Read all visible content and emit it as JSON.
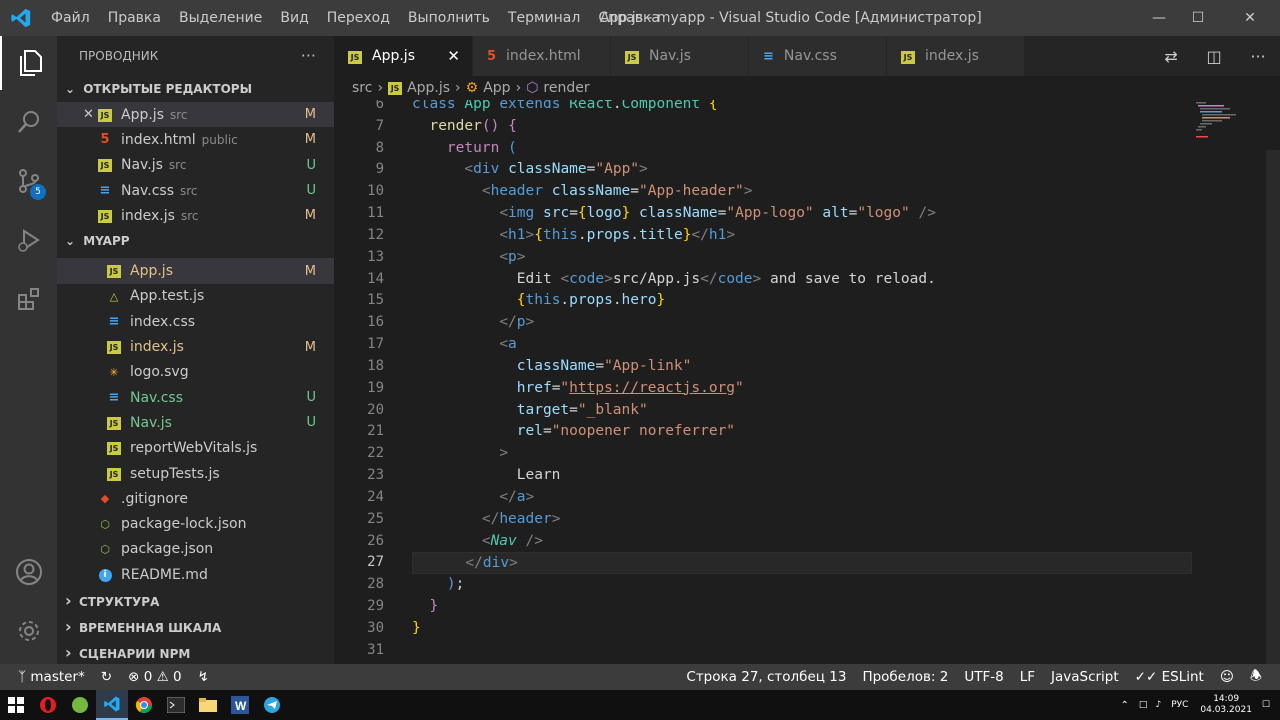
{
  "menu": [
    "Файл",
    "Правка",
    "Выделение",
    "Вид",
    "Переход",
    "Выполнить",
    "Терминал",
    "Справка"
  ],
  "window_title": "App.js - myapp - Visual Studio Code [Администратор]",
  "sidebar": {
    "title": "ПРОВОДНИК",
    "open_editors_label": "ОТКРЫТЫЕ РЕДАКТОРЫ",
    "open_editors": [
      {
        "name": "App.js",
        "dir": "src",
        "status": "M",
        "icon": "js"
      },
      {
        "name": "index.html",
        "dir": "public",
        "status": "M",
        "icon": "html"
      },
      {
        "name": "Nav.js",
        "dir": "src",
        "status": "U",
        "icon": "js"
      },
      {
        "name": "Nav.css",
        "dir": "src",
        "status": "U",
        "icon": "css"
      },
      {
        "name": "index.js",
        "dir": "src",
        "status": "M",
        "icon": "js"
      }
    ],
    "project_label": "MYAPP",
    "files": [
      {
        "name": "App.js",
        "status": "M",
        "icon": "js",
        "indent": 1
      },
      {
        "name": "App.test.js",
        "status": "",
        "icon": "test",
        "indent": 1
      },
      {
        "name": "index.css",
        "status": "",
        "icon": "css",
        "indent": 1
      },
      {
        "name": "index.js",
        "status": "M",
        "icon": "js",
        "indent": 1
      },
      {
        "name": "logo.svg",
        "status": "",
        "icon": "svg",
        "indent": 1
      },
      {
        "name": "Nav.css",
        "status": "U",
        "icon": "css",
        "indent": 1
      },
      {
        "name": "Nav.js",
        "status": "U",
        "icon": "js",
        "indent": 1
      },
      {
        "name": "reportWebVitals.js",
        "status": "",
        "icon": "js",
        "indent": 1
      },
      {
        "name": "setupTests.js",
        "status": "",
        "icon": "js",
        "indent": 1
      },
      {
        "name": ".gitignore",
        "status": "",
        "icon": "git",
        "indent": 0
      },
      {
        "name": "package-lock.json",
        "status": "",
        "icon": "node",
        "indent": 0
      },
      {
        "name": "package.json",
        "status": "",
        "icon": "node",
        "indent": 0
      },
      {
        "name": "README.md",
        "status": "",
        "icon": "info",
        "indent": 0
      }
    ],
    "bottom_sections": [
      "СТРУКТУРА",
      "ВРЕМЕННАЯ ШКАЛА",
      "СЦЕНАРИИ NPM"
    ]
  },
  "tabs": [
    {
      "label": "App.js",
      "icon": "js",
      "active": true
    },
    {
      "label": "index.html",
      "icon": "html",
      "active": false
    },
    {
      "label": "Nav.js",
      "icon": "js",
      "active": false
    },
    {
      "label": "Nav.css",
      "icon": "css",
      "active": false
    },
    {
      "label": "index.js",
      "icon": "js",
      "active": false
    }
  ],
  "breadcrumbs": [
    "src",
    "App.js",
    "App",
    "render"
  ],
  "scm_badge": "5",
  "code": {
    "line_numbers": [
      "6",
      "7",
      "8",
      "9",
      "10",
      "11",
      "12",
      "13",
      "14",
      "15",
      "16",
      "17",
      "18",
      "19",
      "20",
      "21",
      "22",
      "23",
      "24",
      "25",
      "26",
      "27",
      "28",
      "29",
      "30",
      "31"
    ],
    "current_line": "27"
  },
  "statusbar": {
    "branch": "master*",
    "errors": "0",
    "warnings": "0",
    "position": "Строка 27, столбец 13",
    "spaces": "Пробелов: 2",
    "encoding": "UTF-8",
    "eol": "LF",
    "language": "JavaScript",
    "linter": "ESLint"
  },
  "taskbar": {
    "lang": "РУС",
    "time": "14:09",
    "date": "04.03.2021"
  }
}
